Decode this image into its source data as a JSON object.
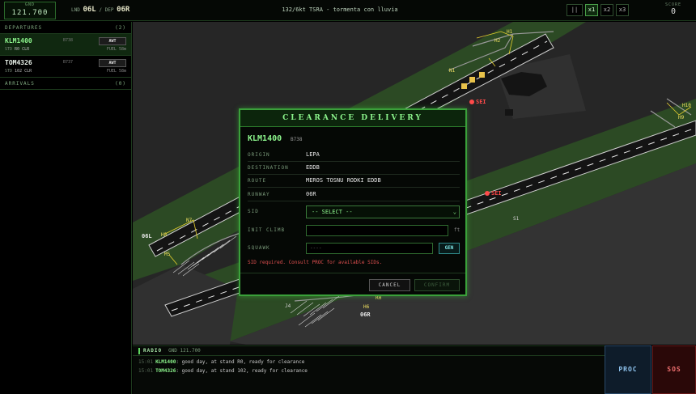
{
  "topbar": {
    "freq_label": "GND",
    "freq_value": "121.700",
    "lnd_label": "LND",
    "lnd_runway": "06L",
    "sep": "/",
    "dep_label": "DEP",
    "dep_runway": "06R",
    "weather": "132/6kt TSRA - tormenta con lluvia",
    "speed_pause": "||",
    "speed_x1": "x1",
    "speed_x2": "x2",
    "speed_x3": "x3",
    "active_speed": "x1",
    "score_label": "SCORE",
    "score_value": "0"
  },
  "sidebar": {
    "departures_label": "DEPARTURES",
    "departures_count": "(2)",
    "arrivals_label": "ARRIVALS",
    "arrivals_count": "(0)",
    "departures": [
      {
        "callsign": "KLM1400",
        "type": "B738",
        "button": "AWT",
        "stand_label": "STD",
        "stand": "R0",
        "status": "CLR",
        "fuel": "FUEL 58m",
        "selected": true
      },
      {
        "callsign": "TOM4326",
        "type": "B737",
        "button": "AWT",
        "stand_label": "STD",
        "stand": "102",
        "status": "CLR",
        "fuel": "FUEL 58m",
        "selected": false
      }
    ]
  },
  "map": {
    "labels": {
      "rwy_06l": "06L",
      "rwy_06r": "06R",
      "seg1": "SEI",
      "seg2": "SEI",
      "h1": "H1",
      "h2": "H2",
      "n1": "N1",
      "h10": "H10",
      "h9": "H9",
      "n7": "N7",
      "s1": "S1",
      "h6": "H6",
      "h8": "H8",
      "m5": "M5",
      "j4": "J4",
      "rh": "RH"
    },
    "colors": {
      "grass": "#2c4a24",
      "runway": "#151515",
      "apron": "#383838",
      "taxi": "#e6cf2e",
      "stand": "#e8c24a",
      "sei": "#ff4a4a"
    }
  },
  "modal": {
    "title": "CLEARANCE DELIVERY",
    "callsign": "KLM1400",
    "type": "B738",
    "fields": [
      {
        "key": "ORIGIN",
        "value": "LEPA"
      },
      {
        "key": "DESTINATION",
        "value": "EDDB"
      },
      {
        "key": "ROUTE",
        "value": "MEROS TOSNU RODKI EDDB"
      },
      {
        "key": "RUNWAY",
        "value": "06R"
      }
    ],
    "sid_label": "SID",
    "sid_value": "-- SELECT --",
    "climb_label": "INIT CLIMB",
    "climb_value": "",
    "climb_unit": "ft",
    "squawk_label": "SQUAWK",
    "squawk_placeholder": "----",
    "gen_label": "GEN",
    "error": "SID required. Consult PROC for available SIDs.",
    "cancel_label": "CANCEL",
    "confirm_label": "CONFIRM"
  },
  "radio": {
    "title": "RADIO",
    "freq": "GND 121.700",
    "messages": [
      {
        "time": "15:01",
        "callsign": "KLM1400",
        "text": ": good day, at stand R0, ready for clearance"
      },
      {
        "time": "15:01",
        "callsign": "TOM4326",
        "text": ": good day, at stand 102, ready for clearance"
      }
    ]
  },
  "buttons": {
    "proc": "PROC",
    "sos": "SOS"
  }
}
